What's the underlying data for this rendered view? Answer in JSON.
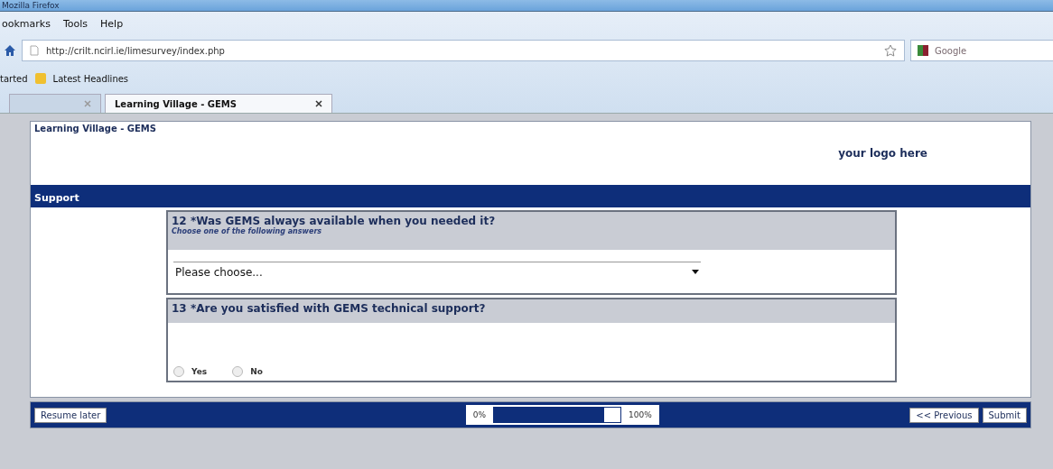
{
  "window": {
    "title": "Mozilla Firefox"
  },
  "menu": [
    "ookmarks",
    "Tools",
    "Help"
  ],
  "address": {
    "value": "http://crilt.ncirl.ie/limesurvey/index.php"
  },
  "search": {
    "placeholder": "Google"
  },
  "bookmarks": [
    "tarted",
    "Latest Headlines"
  ],
  "tabs": [
    {
      "selected": false
    },
    {
      "label": "Learning Village - GEMS",
      "selected": true
    }
  ],
  "survey": {
    "title": "Learning Village - GEMS",
    "logo": "your logo here",
    "group": "Support",
    "questions": [
      {
        "kind": "dropdown",
        "number": "12",
        "mandatory": "*",
        "text": "Was GEMS always available when you needed it?",
        "help": "Choose one of the following answers",
        "value": "Please choose..."
      },
      {
        "kind": "radio",
        "number": "13",
        "mandatory": "*",
        "text": "Are you satisfied with GEMS technical support?",
        "options": [
          {
            "label": "Yes",
            "selected": false
          },
          {
            "label": "No",
            "selected": false
          }
        ]
      }
    ],
    "footer": {
      "resume": "Resume later",
      "progress_start": "0%",
      "progress_end": "100%",
      "level": 0.87,
      "previous": "<< Previous",
      "submit": "Submit"
    }
  }
}
